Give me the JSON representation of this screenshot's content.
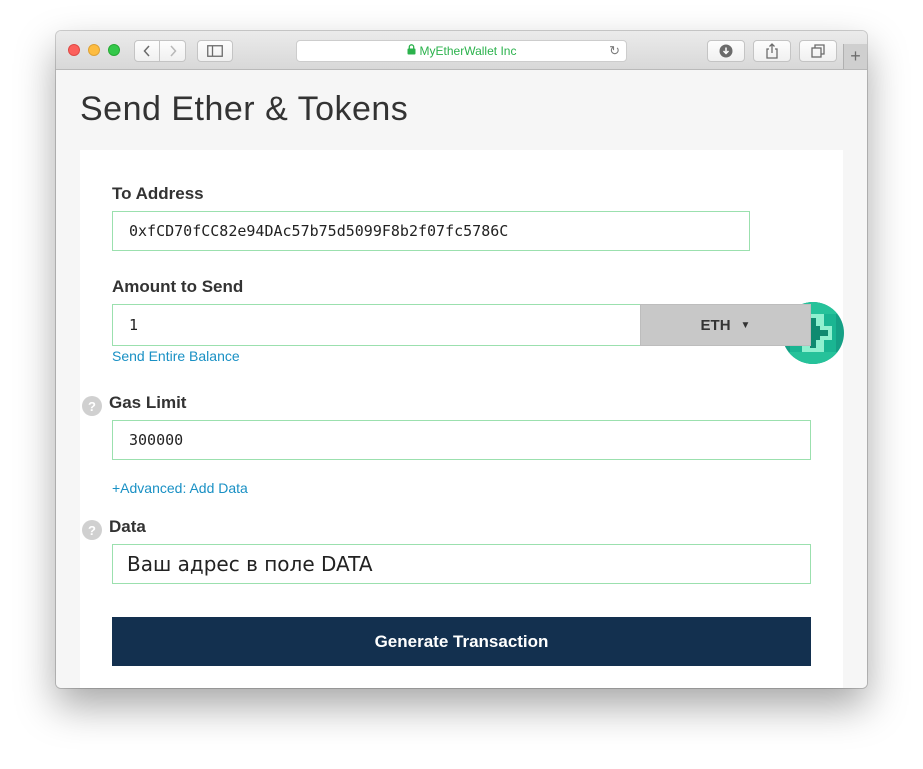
{
  "browser": {
    "address_text": "MyEtherWallet Inc"
  },
  "page": {
    "title": "Send Ether & Tokens"
  },
  "form": {
    "to_address": {
      "label": "To Address",
      "value": "0xfCD70fCC82e94DAc57b75d5099F8b2f07fc5786C"
    },
    "amount": {
      "label": "Amount to Send",
      "value": "1",
      "currency": "ETH",
      "send_entire_balance": "Send Entire Balance"
    },
    "gas_limit": {
      "label": "Gas Limit",
      "value": "300000",
      "help_glyph": "?"
    },
    "advanced_link": "+Advanced: Add Data",
    "data": {
      "label": "Data",
      "value": "Ваш адрес в поле DATA",
      "help_glyph": "?"
    },
    "generate_button": "Generate Transaction"
  },
  "colors": {
    "accent_link": "#1990c4",
    "field_border": "#9be0ae",
    "primary_button": "#13304f",
    "identicon": "#1aa78a"
  }
}
